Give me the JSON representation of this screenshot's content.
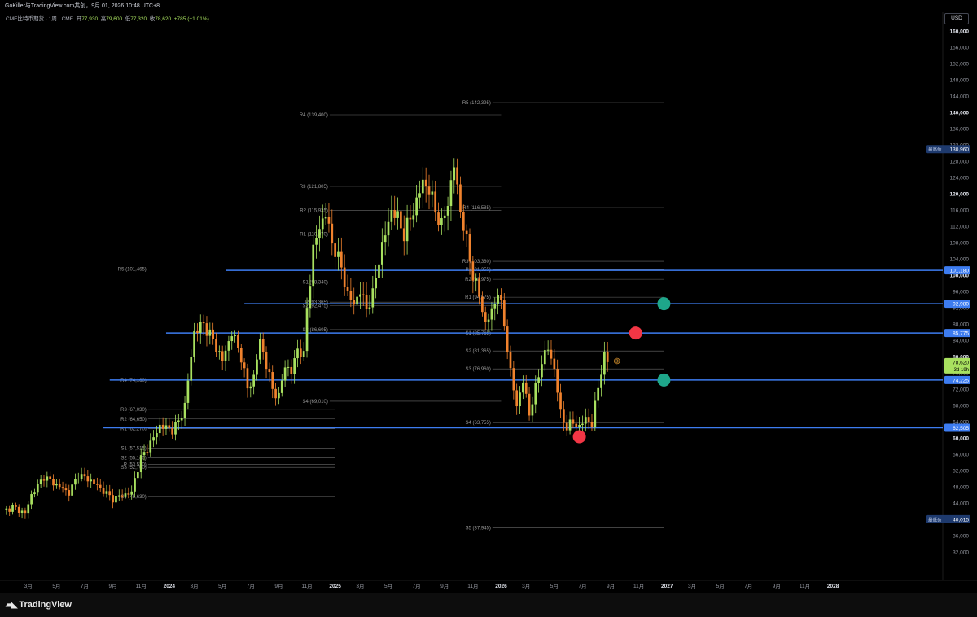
{
  "header": {
    "title": "GoKiller与TradingView.com共创，9月 01, 2026 10:48 UTC+8"
  },
  "legend": {
    "symbol": "CME比特币期货 · 1周 · CME",
    "open_label": "开",
    "open": "77,930",
    "high_label": "高",
    "high": "79,600",
    "low_label": "低",
    "low": "77,320",
    "close_label": "收",
    "close": "78,620",
    "change": "+785 (+1.01%)"
  },
  "currency": "USD",
  "brand": "TradingView",
  "colors": {
    "up": "#a8e05f",
    "down": "#f0822d",
    "hline": "#3d7cf0",
    "pivot": "#6a6a6a",
    "green_marker": "#1ea68a",
    "red_marker": "#f23645",
    "high_badge": "#1e3a6e"
  },
  "chart_data": {
    "type": "candlestick",
    "y_scale": "linear",
    "ylim": [
      28000,
      162000
    ],
    "y_ticks": [
      32000,
      36000,
      40000,
      44000,
      48000,
      52000,
      56000,
      60000,
      64000,
      68000,
      72000,
      76000,
      80000,
      84000,
      88000,
      92000,
      96000,
      100000,
      104000,
      108000,
      112000,
      116000,
      120000,
      124000,
      128000,
      132000,
      136000,
      140000,
      144000,
      148000,
      152000,
      156000,
      160000
    ],
    "y_tick_labels": [
      "32,000",
      "36,000",
      "40,000",
      "44,000",
      "48,000",
      "52,000",
      "56,000",
      "60,000",
      "64,000",
      "68,000",
      "72,000",
      "76,000",
      "80,000",
      "84,000",
      "88,000",
      "92,000",
      "96,000",
      "100,000",
      "104,000",
      "108,000",
      "112,000",
      "116,000",
      "120,000",
      "124,000",
      "128,000",
      "132,000",
      "136,000",
      "140,000",
      "144,000",
      "148,000",
      "152,000",
      "156,000",
      "160,000"
    ],
    "x_range_weeks": [
      0,
      298
    ],
    "x_ticks": [
      {
        "w": 8,
        "label": "3月",
        "bold": false
      },
      {
        "w": 17,
        "label": "5月",
        "bold": false
      },
      {
        "w": 26,
        "label": "7月",
        "bold": false
      },
      {
        "w": 35,
        "label": "9月",
        "bold": false
      },
      {
        "w": 44,
        "label": "11月",
        "bold": false
      },
      {
        "w": 53,
        "label": "2024",
        "bold": true
      },
      {
        "w": 61,
        "label": "3月",
        "bold": false
      },
      {
        "w": 70,
        "label": "5月",
        "bold": false
      },
      {
        "w": 79,
        "label": "7月",
        "bold": false
      },
      {
        "w": 88,
        "label": "9月",
        "bold": false
      },
      {
        "w": 97,
        "label": "11月",
        "bold": false
      },
      {
        "w": 106,
        "label": "2025",
        "bold": true
      },
      {
        "w": 114,
        "label": "3月",
        "bold": false
      },
      {
        "w": 123,
        "label": "5月",
        "bold": false
      },
      {
        "w": 132,
        "label": "7月",
        "bold": false
      },
      {
        "w": 141,
        "label": "9月",
        "bold": false
      },
      {
        "w": 150,
        "label": "11月",
        "bold": false
      },
      {
        "w": 159,
        "label": "2026",
        "bold": true
      },
      {
        "w": 167,
        "label": "3月",
        "bold": false
      },
      {
        "w": 176,
        "label": "5月",
        "bold": false
      },
      {
        "w": 185,
        "label": "7月",
        "bold": false
      },
      {
        "w": 194,
        "label": "9月",
        "bold": false
      },
      {
        "w": 203,
        "label": "11月",
        "bold": false
      },
      {
        "w": 212,
        "label": "2027",
        "bold": true
      },
      {
        "w": 220,
        "label": "3月",
        "bold": false
      },
      {
        "w": 229,
        "label": "5月",
        "bold": false
      },
      {
        "w": 238,
        "label": "7月",
        "bold": false
      },
      {
        "w": 247,
        "label": "9月",
        "bold": false
      },
      {
        "w": 256,
        "label": "11月",
        "bold": false
      },
      {
        "w": 265,
        "label": "2028",
        "bold": true
      }
    ],
    "anchors": [
      [
        0,
        42000
      ],
      [
        3,
        43000
      ],
      [
        7,
        41500
      ],
      [
        9,
        46000
      ],
      [
        13,
        50500
      ],
      [
        17,
        48500
      ],
      [
        21,
        46500
      ],
      [
        24,
        51000
      ],
      [
        28,
        49500
      ],
      [
        32,
        47000
      ],
      [
        35,
        45000
      ],
      [
        38,
        46000
      ],
      [
        41,
        46500
      ],
      [
        42,
        50000
      ],
      [
        44,
        55000
      ],
      [
        46,
        57500
      ],
      [
        48,
        60000
      ],
      [
        50,
        63000
      ],
      [
        52,
        62500
      ],
      [
        54,
        62000
      ],
      [
        56,
        64000
      ],
      [
        58,
        68000
      ],
      [
        61,
        86000
      ],
      [
        64,
        88000
      ],
      [
        67,
        84000
      ],
      [
        70,
        79000
      ],
      [
        73,
        86000
      ],
      [
        76,
        80000
      ],
      [
        78,
        72000
      ],
      [
        80,
        75000
      ],
      [
        82,
        84000
      ],
      [
        84,
        78000
      ],
      [
        86,
        72000
      ],
      [
        88,
        70000
      ],
      [
        90,
        78000
      ],
      [
        92,
        76000
      ],
      [
        94,
        82000
      ],
      [
        96,
        80000
      ],
      [
        97,
        92000
      ],
      [
        98,
        99000
      ],
      [
        99,
        106000
      ],
      [
        101,
        112000
      ],
      [
        103,
        115000
      ],
      [
        105,
        108000
      ],
      [
        106,
        106000
      ],
      [
        108,
        102000
      ],
      [
        110,
        95000
      ],
      [
        112,
        93000
      ],
      [
        114,
        96000
      ],
      [
        116,
        92000
      ],
      [
        118,
        95000
      ],
      [
        120,
        104000
      ],
      [
        122,
        110000
      ],
      [
        124,
        116000
      ],
      [
        126,
        114000
      ],
      [
        128,
        110000
      ],
      [
        130,
        114000
      ],
      [
        132,
        118000
      ],
      [
        134,
        123000
      ],
      [
        136,
        121000
      ],
      [
        138,
        116000
      ],
      [
        140,
        112000
      ],
      [
        142,
        118000
      ],
      [
        144,
        127000
      ],
      [
        146,
        116000
      ],
      [
        148,
        108000
      ],
      [
        150,
        100000
      ],
      [
        152,
        95000
      ],
      [
        154,
        88000
      ],
      [
        156,
        91000
      ],
      [
        158,
        96000
      ],
      [
        160,
        88000
      ],
      [
        162,
        76000
      ],
      [
        164,
        68000
      ],
      [
        166,
        74000
      ],
      [
        168,
        66000
      ],
      [
        170,
        72000
      ],
      [
        172,
        79000
      ],
      [
        174,
        82000
      ],
      [
        176,
        77000
      ],
      [
        178,
        66000
      ],
      [
        180,
        62500
      ],
      [
        182,
        64000
      ],
      [
        184,
        62500
      ],
      [
        186,
        65000
      ],
      [
        188,
        63000
      ],
      [
        190,
        73000
      ],
      [
        192,
        79500
      ],
      [
        193,
        78620
      ]
    ],
    "last_price": 78620,
    "countdown": "3d 19h",
    "highest": {
      "label": "最高价",
      "value": "130,960",
      "v": 130960
    },
    "lowest": {
      "label": "最低价",
      "value": "40,015",
      "v": 40015
    },
    "horizontal_lines": [
      {
        "value": 101180,
        "label": "101,180",
        "from_w": 71
      },
      {
        "value": 92980,
        "label": "92,980",
        "from_w": 77
      },
      {
        "value": 85775,
        "label": "85,775",
        "from_w": 52
      },
      {
        "value": 74225,
        "label": "74,225",
        "from_w": 34
      },
      {
        "value": 62505,
        "label": "62,505",
        "from_w": 32
      }
    ],
    "pivot_sets": [
      {
        "from_w": 40,
        "to_w": 106,
        "levels": [
          {
            "name": "R5",
            "text": "R5 (101,465)",
            "v": 101465
          },
          {
            "name": "R4",
            "text": "R4 (74,160)",
            "v": 74160
          },
          {
            "name": "R3",
            "text": "R3 (67,030)",
            "v": 67030
          },
          {
            "name": "R2",
            "text": "R2 (64,650)",
            "v": 64650
          },
          {
            "name": "R1",
            "text": "R1 (62,270)",
            "v": 62270
          },
          {
            "name": "S1",
            "text": "S1 (57,515)",
            "v": 57515
          },
          {
            "name": "S2",
            "text": "S2 (55,140)",
            "v": 55140
          },
          {
            "name": "P",
            "text": "P (53,530)",
            "v": 53530
          },
          {
            "name": "S3",
            "text": "S3 (52,760)",
            "v": 52760
          },
          {
            "name": "S4",
            "text": "S4 (45,630)",
            "v": 45630
          }
        ]
      },
      {
        "from_w": 98,
        "to_w": 159,
        "levels": [
          {
            "name": "R4",
            "text": "R4 (139,400)",
            "v": 139400
          },
          {
            "name": "R3",
            "text": "R3 (121,805)",
            "v": 121805
          },
          {
            "name": "R2",
            "text": "R2 (115,935)",
            "v": 115935
          },
          {
            "name": "R1",
            "text": "R1 (110,070)",
            "v": 110070
          },
          {
            "name": "S1",
            "text": "S1 (98,340)",
            "v": 98340
          },
          {
            "name": "P",
            "text": "P (93,365)",
            "v": 93365
          },
          {
            "name": "S2",
            "text": "S2 (92,475)",
            "v": 92475
          },
          {
            "name": "S3",
            "text": "S3 (86,605)",
            "v": 86605
          },
          {
            "name": "S4",
            "text": "S4 (69,010)",
            "v": 69010
          }
        ]
      },
      {
        "from_w": 150,
        "to_w": 211,
        "levels": [
          {
            "name": "R5",
            "text": "R5 (142,395)",
            "v": 142395
          },
          {
            "name": "R4",
            "text": "R4 (116,585)",
            "v": 116585
          },
          {
            "name": "R3",
            "text": "R3 (103,380)",
            "v": 103380
          },
          {
            "name": "P",
            "text": "P (101,355)",
            "v": 101355
          },
          {
            "name": "R2",
            "text": "R2 (98,975)",
            "v": 98975
          },
          {
            "name": "R1",
            "text": "R1 (94,575)",
            "v": 94575
          },
          {
            "name": "S1",
            "text": "S1 (85,765)",
            "v": 85765
          },
          {
            "name": "S2",
            "text": "S2 (81,365)",
            "v": 81365
          },
          {
            "name": "S3",
            "text": "S3 (76,960)",
            "v": 76960
          },
          {
            "name": "S4",
            "text": "S4 (63,755)",
            "v": 63755
          },
          {
            "name": "S5",
            "text": "S5 (37,945)",
            "v": 37945
          }
        ]
      }
    ],
    "markers": [
      {
        "w": 211,
        "v": 92980,
        "color": "green"
      },
      {
        "w": 202,
        "v": 85775,
        "color": "red"
      },
      {
        "w": 211,
        "v": 74225,
        "color": "green"
      },
      {
        "w": 184,
        "v": 60300,
        "color": "red"
      }
    ],
    "dividend_marker": {
      "w": 196,
      "v": 78900,
      "label": "D"
    }
  }
}
